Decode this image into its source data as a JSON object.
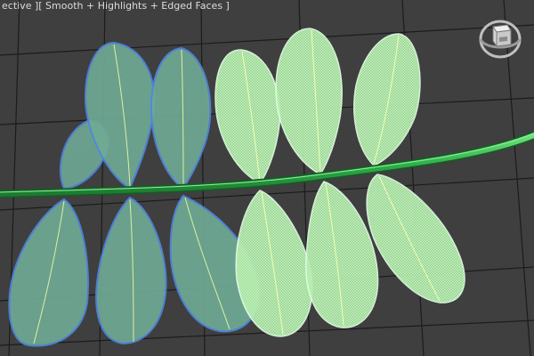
{
  "viewport": {
    "label_parts": [
      "ective ]",
      " [ Smooth + Highlights + Edged Faces ]"
    ],
    "shading_mode": "Smooth + Highlights + Edged Faces"
  },
  "colors": {
    "background": "#3f3f3f",
    "grid": "#1e1e1e",
    "stem": "#2fae4a",
    "leaf_selected_fill": "#7bb87a",
    "leaf_selected_wire": "#4f86e6",
    "leaf_unselected_fill": "#a6e89c",
    "leaf_unselected_wire": "#e2ffe6"
  },
  "scene": {
    "objects": [
      {
        "name": "stem",
        "selected": false
      },
      {
        "name": "leaf",
        "selected": true
      },
      {
        "name": "leaf",
        "selected": false
      }
    ]
  },
  "navigation": {
    "viewcube_icon": "viewcube-icon"
  }
}
